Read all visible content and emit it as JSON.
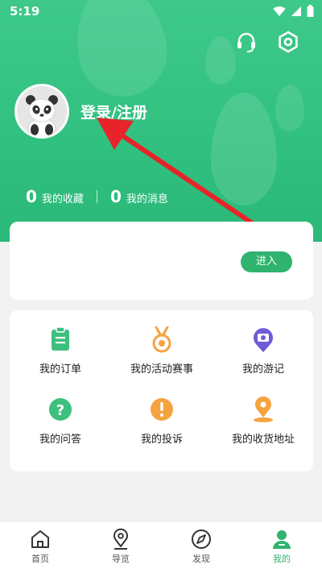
{
  "status_bar": {
    "time": "5:19"
  },
  "profile": {
    "login_label": "登录/注册"
  },
  "stats": [
    {
      "count": "0",
      "label": "我的收藏"
    },
    {
      "count": "0",
      "label": "我的消息"
    }
  ],
  "enter_button": "进入",
  "menu": [
    {
      "label": "我的订单",
      "icon": "clipboard-icon",
      "color": "#3dbf7e"
    },
    {
      "label": "我的活动赛事",
      "icon": "medal-icon",
      "color": "#f5a340"
    },
    {
      "label": "我的游记",
      "icon": "camera-pin-icon",
      "color": "#6e5bd8"
    },
    {
      "label": "我的问答",
      "icon": "question-icon",
      "color": "#3dbf7e"
    },
    {
      "label": "我的投诉",
      "icon": "alert-icon",
      "color": "#f5a340"
    },
    {
      "label": "我的收货地址",
      "icon": "location-pin-icon",
      "color": "#f5a340"
    }
  ],
  "tabs": [
    {
      "label": "首页",
      "icon": "home-icon"
    },
    {
      "label": "导览",
      "icon": "map-pin-icon"
    },
    {
      "label": "发现",
      "icon": "compass-icon"
    },
    {
      "label": "我的",
      "icon": "user-icon"
    }
  ],
  "colors": {
    "primary": "#2fb36e",
    "header": "#34c282",
    "annotation_arrow": "#e8232a"
  }
}
